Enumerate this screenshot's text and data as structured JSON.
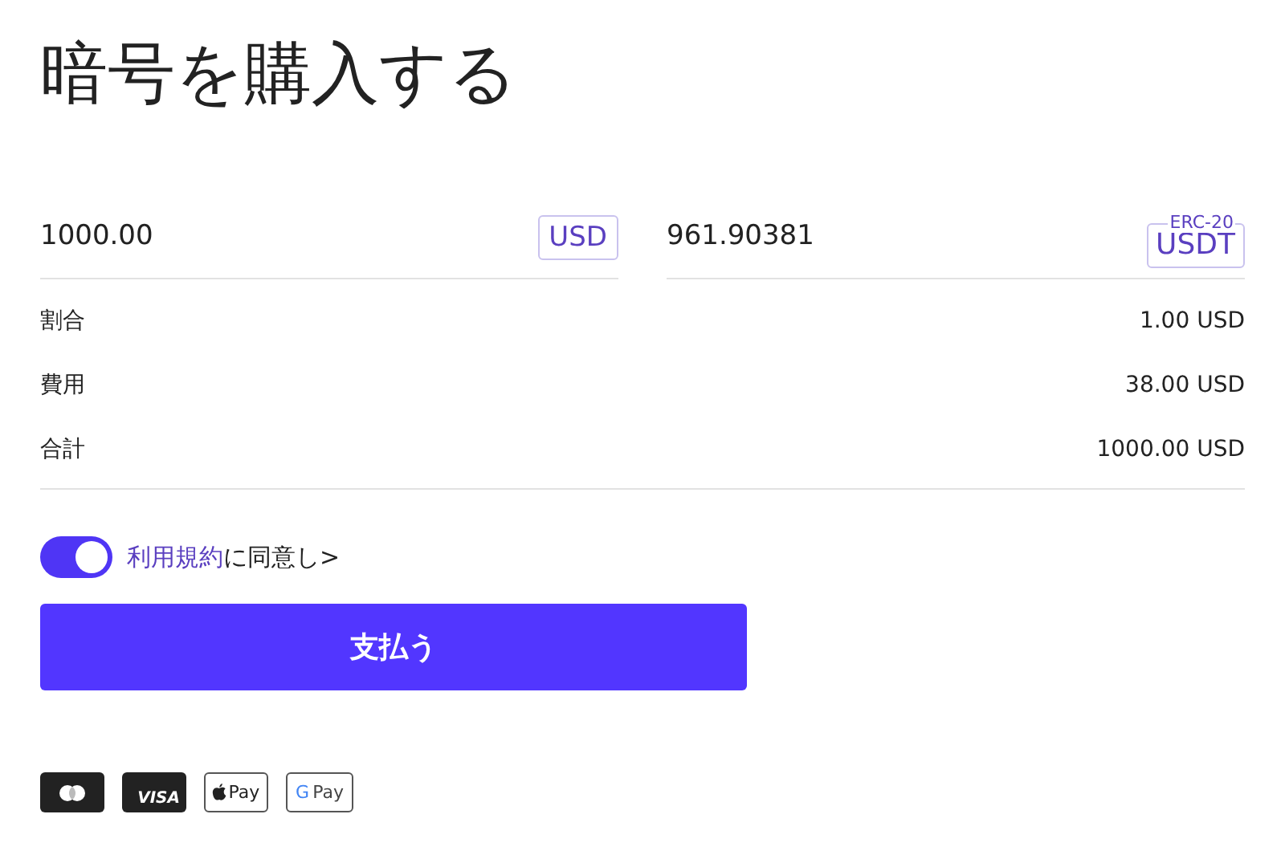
{
  "title": "暗号を購入する",
  "pay_field": {
    "value": "1000.00",
    "currency": "USD"
  },
  "receive_field": {
    "value": "961.90381",
    "currency": "USDT",
    "network": "ERC-20"
  },
  "summary": [
    {
      "label": "割合",
      "value": "1.00 USD"
    },
    {
      "label": "費用",
      "value": "38.00 USD"
    },
    {
      "label": "合計",
      "value": "1000.00 USD"
    }
  ],
  "terms": {
    "on": true,
    "link": "利用規約",
    "text": "に同意し>"
  },
  "pay_button": "支払う",
  "payment_methods": [
    {
      "kind": "mastercard"
    },
    {
      "kind": "visa",
      "label": "VISA"
    },
    {
      "kind": "applepay",
      "label": "Pay"
    },
    {
      "kind": "googlepay",
      "mark": "G",
      "label": "Pay"
    }
  ]
}
